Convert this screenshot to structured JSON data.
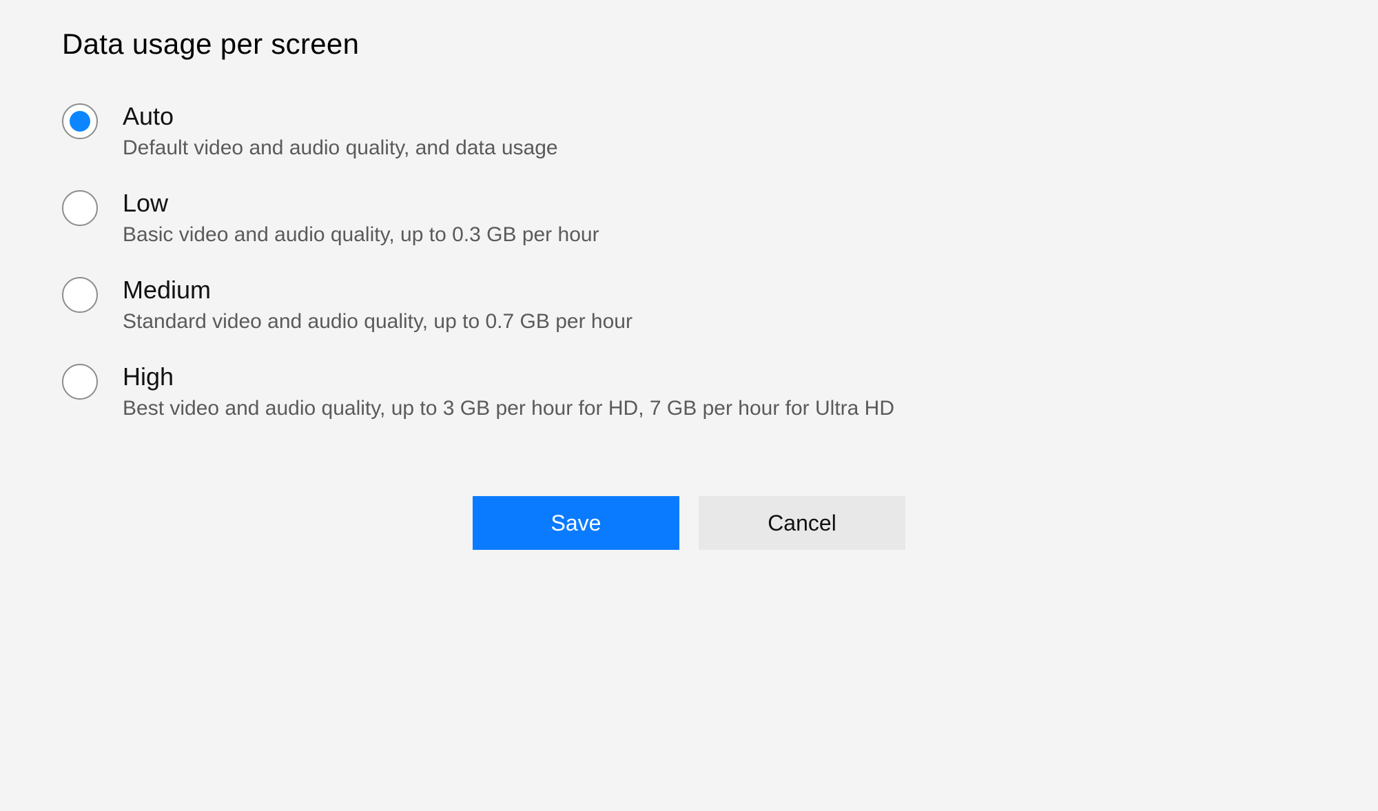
{
  "heading": "Data usage per screen",
  "selected_index": 0,
  "options": [
    {
      "label": "Auto",
      "description": "Default video and audio quality, and data usage"
    },
    {
      "label": "Low",
      "description": "Basic video and audio quality, up to 0.3 GB per hour"
    },
    {
      "label": "Medium",
      "description": "Standard video and audio quality, up to 0.7 GB per hour"
    },
    {
      "label": "High",
      "description": "Best video and audio quality, up to 3 GB per hour for HD, 7 GB per hour for Ultra HD"
    }
  ],
  "buttons": {
    "save": "Save",
    "cancel": "Cancel"
  }
}
